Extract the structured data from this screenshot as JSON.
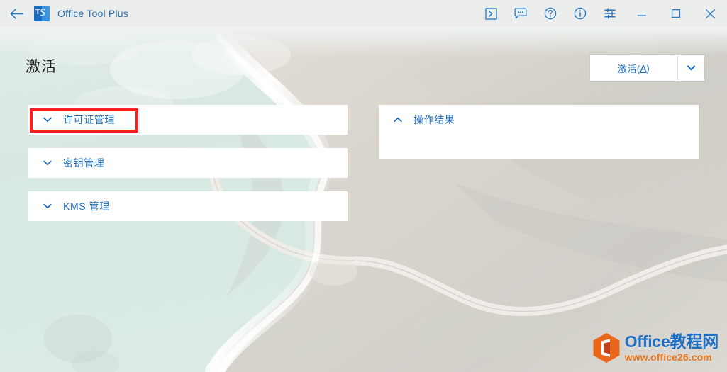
{
  "titlebar": {
    "back_icon": "back-arrow-icon",
    "app_logo": "office-tool-plus-logo",
    "logo_letter": "T",
    "logo_mark": "S",
    "title": "Office Tool Plus",
    "buttons": [
      {
        "name": "console-button",
        "icon": "console-icon",
        "tooltip": "Console"
      },
      {
        "name": "feedback-button",
        "icon": "feedback-icon",
        "tooltip": "Feedback"
      },
      {
        "name": "help-button",
        "icon": "help-icon",
        "tooltip": "Help"
      },
      {
        "name": "about-button",
        "icon": "info-icon",
        "tooltip": "About"
      },
      {
        "name": "settings-button",
        "icon": "sliders-icon",
        "tooltip": "Settings"
      }
    ],
    "window_controls": [
      {
        "name": "minimize-button",
        "icon": "minimize-icon"
      },
      {
        "name": "maximize-button",
        "icon": "maximize-icon"
      },
      {
        "name": "close-button",
        "icon": "close-icon"
      }
    ]
  },
  "page": {
    "title": "激活"
  },
  "action_button": {
    "label_main": "激活(",
    "label_accesskey": "A",
    "label_close": ")",
    "dropdown_icon": "chevron-down-icon"
  },
  "left_panels": [
    {
      "label": "许可证管理",
      "chevron": "chevron-down-icon",
      "expanded": false,
      "highlighted": true
    },
    {
      "label": "密钥管理",
      "chevron": "chevron-down-icon",
      "expanded": false,
      "highlighted": false
    },
    {
      "label": "KMS 管理",
      "chevron": "chevron-down-icon",
      "expanded": false,
      "highlighted": false
    }
  ],
  "right_panels": [
    {
      "label": "操作结果",
      "chevron": "chevron-up-icon",
      "expanded": true,
      "body_text": ""
    }
  ],
  "watermark": {
    "icon": "office-hexagon-logo",
    "brand": "Office教程网",
    "url": "www.office26.com"
  },
  "colors": {
    "accent_blue": "#1b6ec2",
    "title_bar_bg": "#eceeee",
    "annotation_red": "#fb2020",
    "watermark_blue": "#1f6fc4",
    "watermark_orange": "#e8761c",
    "card_white": "#ffffff"
  }
}
